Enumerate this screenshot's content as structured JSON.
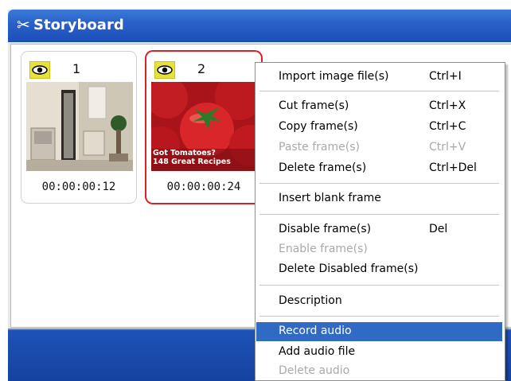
{
  "window": {
    "title": "Storyboard",
    "icon": "storyboard-scissors-icon",
    "accent": "#2a61c9"
  },
  "frames": [
    {
      "number": "1",
      "time": "00:00:00:12",
      "selected": false,
      "thumbnail": "room-interior-image"
    },
    {
      "number": "2",
      "time": "00:00:00:24",
      "selected": true,
      "thumbnail": "tomatoes-cover-image",
      "thumbnail_text": [
        "Got Tomatoes?",
        "148 Great Recipes"
      ]
    }
  ],
  "context_menu": {
    "items": [
      {
        "label": "Import image file(s)",
        "shortcut": "Ctrl+I",
        "enabled": true
      },
      {
        "label": "Cut frame(s)",
        "shortcut": "Ctrl+X",
        "enabled": true
      },
      {
        "label": "Copy frame(s)",
        "shortcut": "Ctrl+C",
        "enabled": true
      },
      {
        "label": "Paste frame(s)",
        "shortcut": "Ctrl+V",
        "enabled": false
      },
      {
        "label": "Delete frame(s)",
        "shortcut": "Ctrl+Del",
        "enabled": true
      },
      {
        "label": "Insert blank frame",
        "shortcut": "",
        "enabled": true
      },
      {
        "label": "Disable frame(s)",
        "shortcut": "Del",
        "enabled": true
      },
      {
        "label": "Enable frame(s)",
        "shortcut": "",
        "enabled": false
      },
      {
        "label": "Delete Disabled frame(s)",
        "shortcut": "",
        "enabled": true
      },
      {
        "label": "Description",
        "shortcut": "",
        "enabled": true
      },
      {
        "label": "Record audio",
        "shortcut": "",
        "enabled": true,
        "highlighted": true
      },
      {
        "label": "Add audio file",
        "shortcut": "",
        "enabled": true
      },
      {
        "label": "Delete audio",
        "shortcut": "",
        "enabled": false
      }
    ],
    "highlight_color": "#316ac5"
  }
}
